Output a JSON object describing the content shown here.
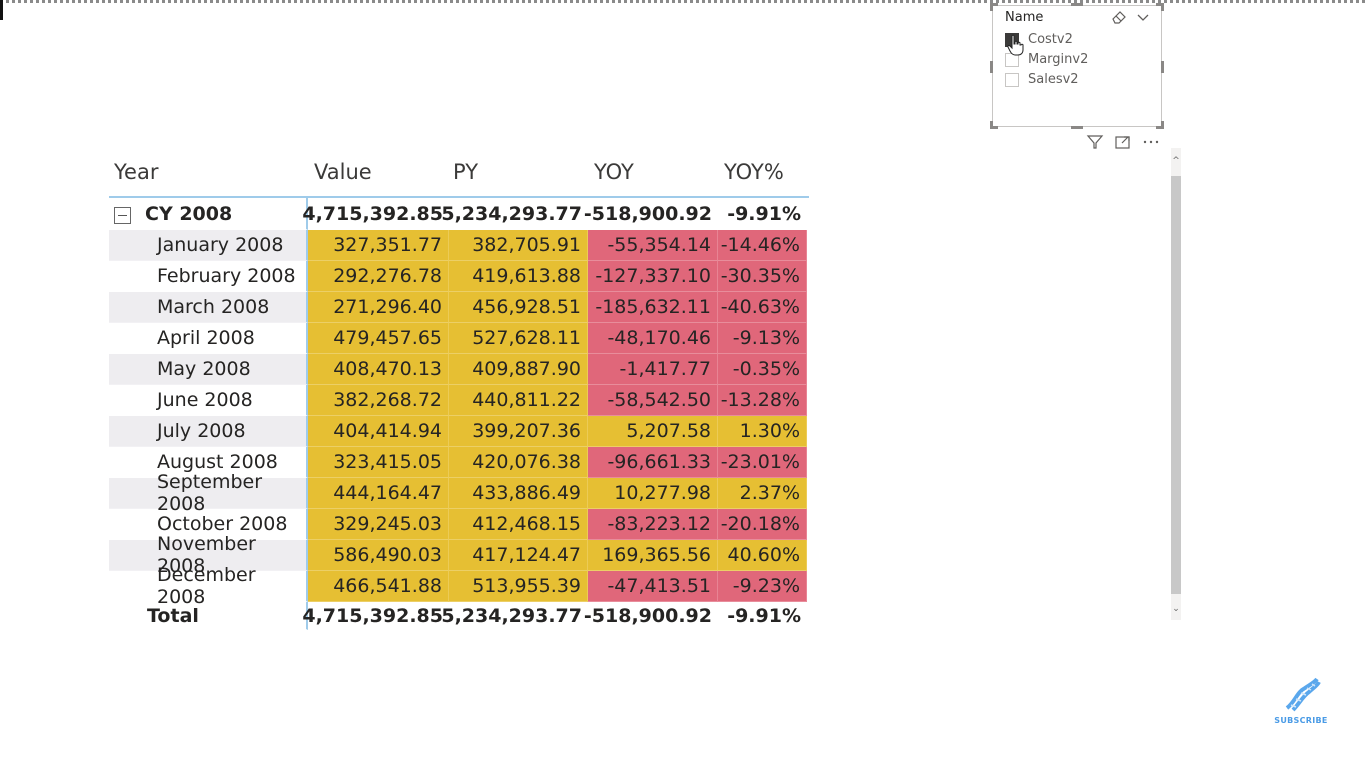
{
  "slicer": {
    "title": "Name",
    "options": [
      {
        "label": "Costv2",
        "checked": true
      },
      {
        "label": "Marginv2",
        "checked": false
      },
      {
        "label": "Salesv2",
        "checked": false
      }
    ]
  },
  "matrix": {
    "headers": [
      "Year",
      "Value",
      "PY",
      "YOY",
      "YOY%"
    ],
    "group": {
      "label": "CY 2008",
      "value": "4,715,392.85",
      "py": "5,234,293.77",
      "yoy": "-518,900.92",
      "yoy_pct": "-9.91%"
    },
    "rows": [
      {
        "label": "January 2008",
        "value": "327,351.77",
        "py": "382,705.91",
        "yoy": "-55,354.14",
        "yoy_pct": "-14.46%",
        "status": "negative"
      },
      {
        "label": "February 2008",
        "value": "292,276.78",
        "py": "419,613.88",
        "yoy": "-127,337.10",
        "yoy_pct": "-30.35%",
        "status": "negative"
      },
      {
        "label": "March 2008",
        "value": "271,296.40",
        "py": "456,928.51",
        "yoy": "-185,632.11",
        "yoy_pct": "-40.63%",
        "status": "negative"
      },
      {
        "label": "April 2008",
        "value": "479,457.65",
        "py": "527,628.11",
        "yoy": "-48,170.46",
        "yoy_pct": "-9.13%",
        "status": "negative"
      },
      {
        "label": "May 2008",
        "value": "408,470.13",
        "py": "409,887.90",
        "yoy": "-1,417.77",
        "yoy_pct": "-0.35%",
        "status": "negative"
      },
      {
        "label": "June 2008",
        "value": "382,268.72",
        "py": "440,811.22",
        "yoy": "-58,542.50",
        "yoy_pct": "-13.28%",
        "status": "negative"
      },
      {
        "label": "July 2008",
        "value": "404,414.94",
        "py": "399,207.36",
        "yoy": "5,207.58",
        "yoy_pct": "1.30%",
        "status": "positive"
      },
      {
        "label": "August 2008",
        "value": "323,415.05",
        "py": "420,076.38",
        "yoy": "-96,661.33",
        "yoy_pct": "-23.01%",
        "status": "negative"
      },
      {
        "label": "September 2008",
        "value": "444,164.47",
        "py": "433,886.49",
        "yoy": "10,277.98",
        "yoy_pct": "2.37%",
        "status": "positive"
      },
      {
        "label": "October 2008",
        "value": "329,245.03",
        "py": "412,468.15",
        "yoy": "-83,223.12",
        "yoy_pct": "-20.18%",
        "status": "negative"
      },
      {
        "label": "November 2008",
        "value": "586,490.03",
        "py": "417,124.47",
        "yoy": "169,365.56",
        "yoy_pct": "40.60%",
        "status": "positive"
      },
      {
        "label": "December 2008",
        "value": "466,541.88",
        "py": "513,955.39",
        "yoy": "-47,413.51",
        "yoy_pct": "-9.23%",
        "status": "negative"
      }
    ],
    "total": {
      "label": "Total",
      "value": "4,715,392.85",
      "py": "5,234,293.77",
      "yoy": "-518,900.92",
      "yoy_pct": "-9.91%"
    }
  },
  "colors": {
    "positive": "#e6bf33",
    "negative": "#e0677a",
    "accent": "#9fcbea"
  },
  "visual_icons": [
    "filter-icon",
    "focus-mode-icon",
    "more-options-icon"
  ],
  "subscribe": {
    "label": "SUBSCRIBE"
  }
}
